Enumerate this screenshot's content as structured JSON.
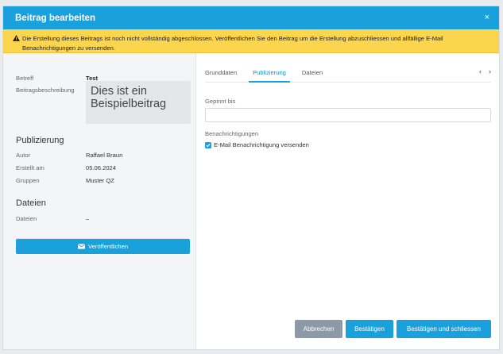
{
  "dialog": {
    "title": "Beitrag bearbeiten",
    "close_label": "×"
  },
  "warning": {
    "text": "Die Erstellung dieses Beitrags ist noch nicht vollständig abgeschlossen. Veröffentlichen Sie den Beitrag um die Erstellung abzuschliessen und allfällige E-Mail Benachrichtigungen zu versenden."
  },
  "details": {
    "subject_label": "Betreff",
    "subject_value": "Test",
    "description_label": "Beitragsbeschreibung",
    "description_value": "Dies ist ein Beispielbeitrag"
  },
  "publication": {
    "heading": "Publizierung",
    "author_label": "Autor",
    "author_value": "Raffael Braun",
    "created_label": "Erstellt am",
    "created_value": "05.06.2024",
    "groups_label": "Gruppen",
    "groups_value": "Muster QZ"
  },
  "files": {
    "heading": "Dateien",
    "files_label": "Dateien",
    "files_value": "–"
  },
  "publish_button": {
    "label": "Veröffentlichen",
    "icon": "envelope-icon"
  },
  "tabs": [
    {
      "label": "Grunddaten",
      "active": false
    },
    {
      "label": "Publizierung",
      "active": true
    },
    {
      "label": "Dateien",
      "active": false
    }
  ],
  "tab_nav": {
    "prev": "‹",
    "next": "›"
  },
  "form": {
    "pinned_until_label": "Gepinnt bis",
    "pinned_until_value": "",
    "notifications_label": "Benachrichtigungen",
    "email_checkbox_label": "E-Mail Benachrichtigung versenden",
    "email_checkbox_checked": true
  },
  "footer": {
    "cancel_label": "Abbrechen",
    "confirm_label": "Bestätigen",
    "confirm_close_label": "Bestätigen und schliessen"
  },
  "colors": {
    "accent": "#1aa0db",
    "warning_bg": "#fcd54e",
    "cancel_bg": "#8c99a6"
  }
}
